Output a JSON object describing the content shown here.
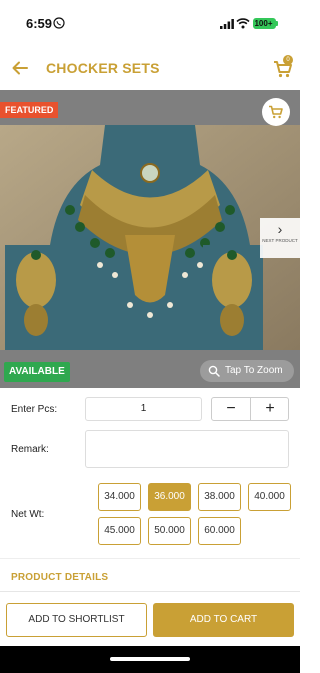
{
  "status": {
    "time": "6:59",
    "battery": "100+"
  },
  "header": {
    "title": "CHOCKER SETS",
    "cart_count": "0"
  },
  "product": {
    "featured_label": "FEATURED",
    "availability": "AVAILABLE",
    "zoom_label": "Tap To Zoom",
    "next_label": "NEXT PRODUCT"
  },
  "form": {
    "pcs_label": "Enter Pcs:",
    "pcs_value": "1",
    "remark_label": "Remark:",
    "remark_value": "",
    "netwt_label": "Net Wt:",
    "netwt_options": [
      "34.000",
      "36.000",
      "38.000",
      "40.000",
      "45.000",
      "50.000",
      "60.000"
    ],
    "netwt_selected": "36.000",
    "decrement": "−",
    "increment": "+"
  },
  "details": {
    "title": "PRODUCT DETAILS"
  },
  "actions": {
    "shortlist": "ADD TO SHORTLIST",
    "add_to_cart": "ADD TO CART"
  },
  "colors": {
    "accent": "#c9a035",
    "featured": "#e8522e",
    "available": "#2fa84f",
    "battery": "#34c759"
  }
}
